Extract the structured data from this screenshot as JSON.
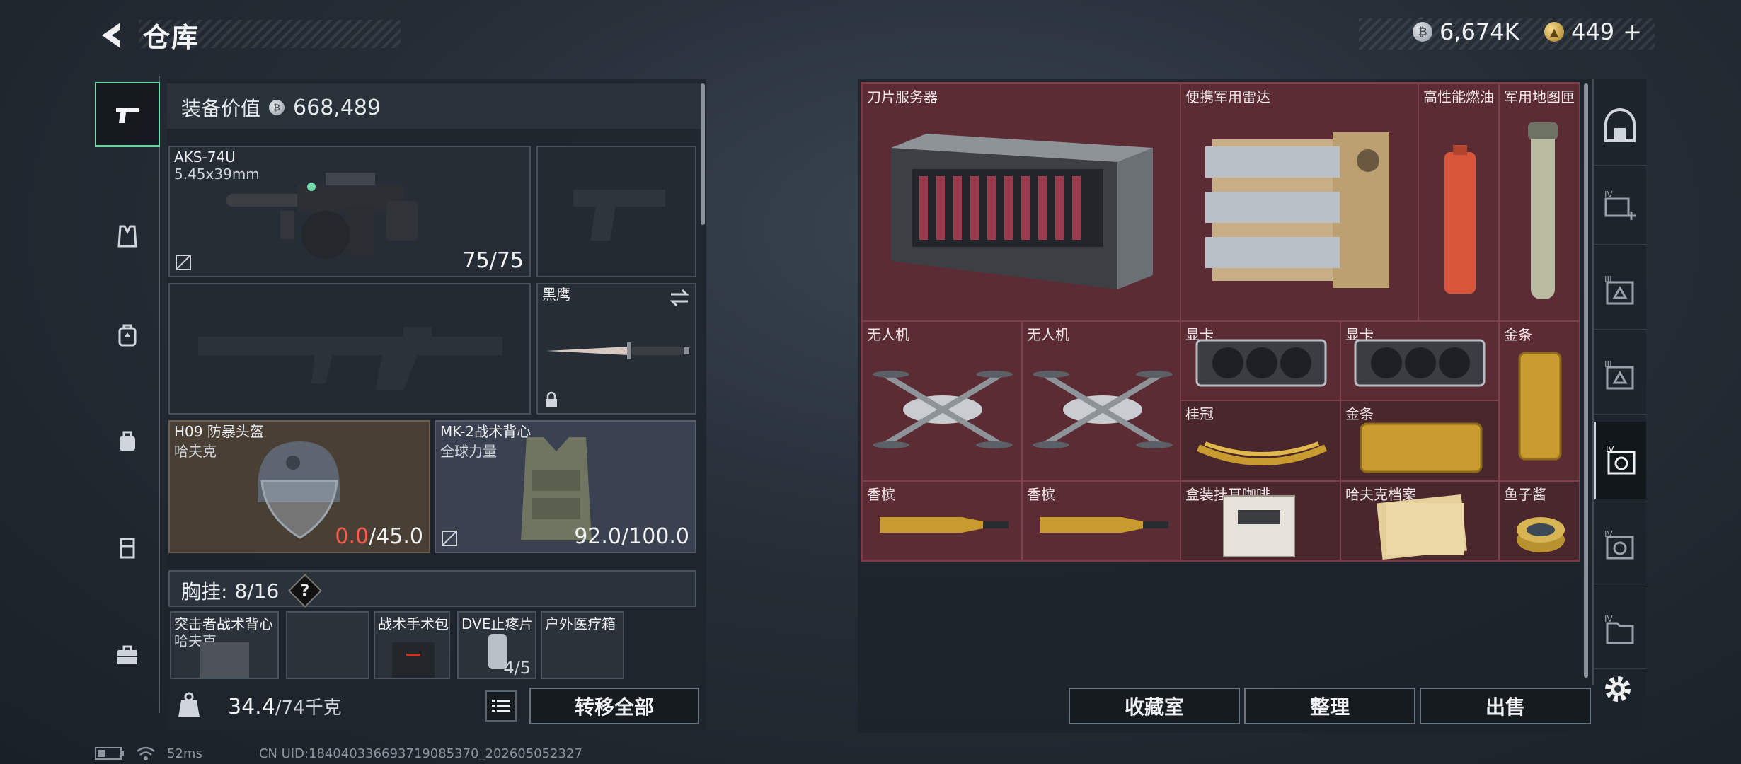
{
  "header": {
    "title": "仓库"
  },
  "currency": {
    "silver": "6,674K",
    "gold": "449",
    "gold_plus": "+"
  },
  "equipment": {
    "label": "装备价值",
    "value": "668,489",
    "primary": {
      "name": "AKS-74U",
      "ammo": "5.45x39mm",
      "count": "75/75"
    },
    "melee": {
      "name": "黑鹰"
    },
    "helmet": {
      "name": "H09 防暴头盔",
      "brand": "哈夫克",
      "durability_current": "0.0",
      "durability_max": "/45.0"
    },
    "armor": {
      "name": "MK-2战术背心",
      "brand": "全球力量",
      "durability": "92.0/100.0"
    }
  },
  "rig": {
    "label": "胸挂:",
    "capacity": "8/16",
    "help": "?",
    "items": [
      {
        "name": "突击者战术背心",
        "sub": "哈夫克"
      },
      {
        "name": ""
      },
      {
        "name": "战术手术包"
      },
      {
        "name": "DVE止疼片",
        "sub": "4/5"
      },
      {
        "name": "户外医疗箱"
      }
    ]
  },
  "weight": {
    "current": "34.4",
    "max": "/74千克"
  },
  "buttons": {
    "transfer_all": "转移全部",
    "collection": "收藏室",
    "sort": "整理",
    "sell": "出售"
  },
  "storage": {
    "items": [
      {
        "name": "刀片服务器"
      },
      {
        "name": "便携军用雷达"
      },
      {
        "name": "高性能燃油"
      },
      {
        "name": "军用地图匣"
      },
      {
        "name": "无人机"
      },
      {
        "name": "无人机"
      },
      {
        "name": "显卡"
      },
      {
        "name": "显卡"
      },
      {
        "name": "金条"
      },
      {
        "name": "桂冠"
      },
      {
        "name": "金条"
      },
      {
        "name": "香槟"
      },
      {
        "name": "香槟"
      },
      {
        "name": "盒装挂耳咖啡"
      },
      {
        "name": "哈夫克档案"
      },
      {
        "name": "鱼子酱"
      }
    ]
  },
  "status": {
    "ping": "52ms",
    "uid": "CN UID:184040336693719085370_202605052327"
  },
  "colors": {
    "accent_green": "#6fd6a6",
    "storage_red": "#5c2c35",
    "durability_low": "#ff5a4a"
  },
  "icons": {
    "left_rail": [
      "pistol-icon",
      "vest-icon",
      "backpack-icon",
      "bag-icon",
      "pouch-icon",
      "briefcase-icon"
    ],
    "right_rail": [
      "safe-icon",
      "storage-add-icon",
      "storage-3-icon",
      "storage-4-icon",
      "storage-5-icon",
      "storage-6-icon",
      "storage-7-icon"
    ]
  }
}
